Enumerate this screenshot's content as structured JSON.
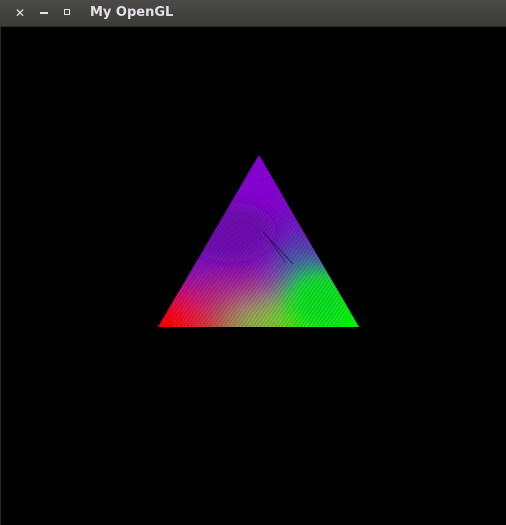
{
  "window": {
    "title": "My OpenGL",
    "controls": {
      "close_icon": "close-icon",
      "minimize_icon": "minimize-icon",
      "maximize_icon": "maximize-icon"
    }
  },
  "scene": {
    "background": "#000000",
    "shape": "triangle",
    "vertex_colors": {
      "top": "#8800cc",
      "bottom_left": "#ff0000",
      "bottom_right": "#00ff00"
    }
  }
}
